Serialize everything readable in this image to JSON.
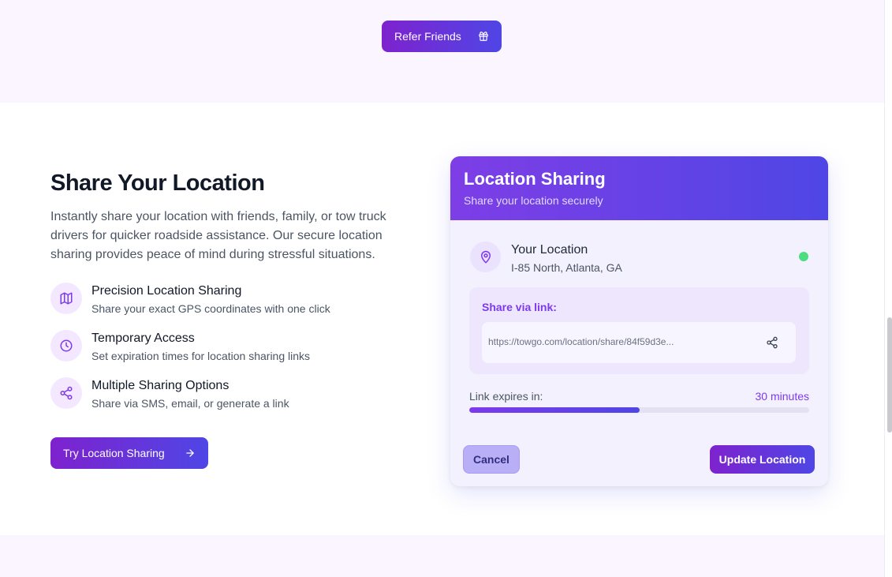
{
  "refer": {
    "label": "Refer Friends",
    "icon": "gift-icon"
  },
  "hero": {
    "title": "Share Your Location",
    "description": "Instantly share your location with friends, family, or tow truck drivers for quicker roadside assistance. Our secure location sharing provides peace of mind during stressful situations."
  },
  "features": [
    {
      "title": "Precision Location Sharing",
      "subtitle": "Share your exact GPS coordinates with one click",
      "icon": "map-icon"
    },
    {
      "title": "Temporary Access",
      "subtitle": "Set expiration times for location sharing links",
      "icon": "clock-icon"
    },
    {
      "title": "Multiple Sharing Options",
      "subtitle": "Share via SMS, email, or generate a link",
      "icon": "share-icon"
    }
  ],
  "cta": {
    "label": "Try Location Sharing",
    "icon": "arrow-right-icon"
  },
  "card": {
    "title": "Location Sharing",
    "subtitle": "Share your location securely",
    "location_title": "Your Location",
    "location_address": "I-85 North, Atlanta, GA",
    "status": "online",
    "share_label": "Share via link:",
    "share_link": "https://towgo.com/location/share/84f59d3e...",
    "expires_label": "Link expires in:",
    "expires_value": "30 minutes",
    "expires_progress_percent": 50,
    "cancel_label": "Cancel",
    "update_label": "Update Location"
  },
  "colors": {
    "accent_purple": "#7e22ce",
    "accent_indigo": "#4f46e5",
    "band_bg": "#faf5ff",
    "status_green": "#4ade80"
  }
}
